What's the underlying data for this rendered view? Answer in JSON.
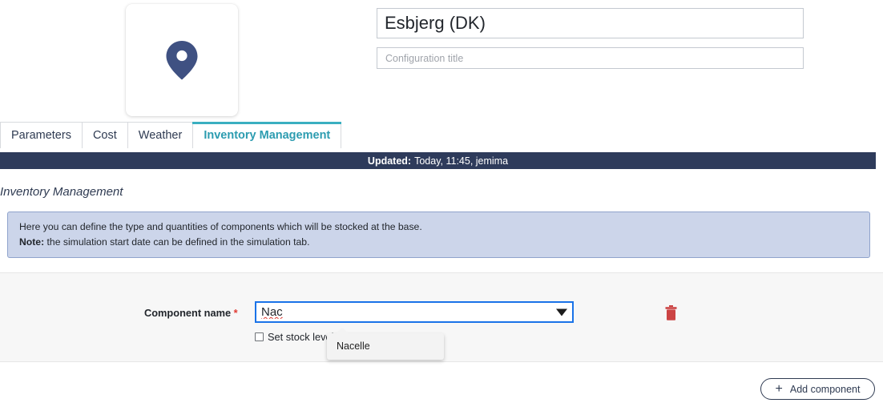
{
  "header": {
    "location_icon": "map-pin-icon",
    "title_value": "Esbjerg (DK)",
    "subtitle_value": "",
    "subtitle_placeholder": "Configuration title"
  },
  "tabs": [
    {
      "label": "Parameters",
      "active": false
    },
    {
      "label": "Cost",
      "active": false
    },
    {
      "label": "Weather",
      "active": false
    },
    {
      "label": "Inventory Management",
      "active": true
    }
  ],
  "updated": {
    "label": "Updated:",
    "value": "Today, 11:45, jemima"
  },
  "section": {
    "title": "Inventory Management"
  },
  "info": {
    "line1": "Here you can define the type and quantities of components which will be stocked at the base.",
    "note_label": "Note:",
    "note_text": " the simulation start date can be defined in the simulation tab."
  },
  "component_form": {
    "name_label": "Component name",
    "required_marker": "*",
    "name_value": "Nac",
    "dropdown_icon": "chevron-down-icon",
    "checkbox_label": "Set stock level",
    "checkbox_checked": false,
    "delete_icon": "trash-icon",
    "suggestions": [
      "Nacelle"
    ]
  },
  "footer": {
    "add_icon": "plus-icon",
    "add_label": "Add component"
  },
  "colors": {
    "accent_teal": "#3aafc0",
    "dark_navy": "#2e3b5b",
    "info_bg": "#ccd5ea",
    "info_border": "#8fa3cc",
    "focus_blue": "#1a73e8",
    "danger_red": "#cc4444",
    "required_red": "#e03b33",
    "panel_gray": "#f7f7f7",
    "pin_blue": "#3f5182"
  }
}
